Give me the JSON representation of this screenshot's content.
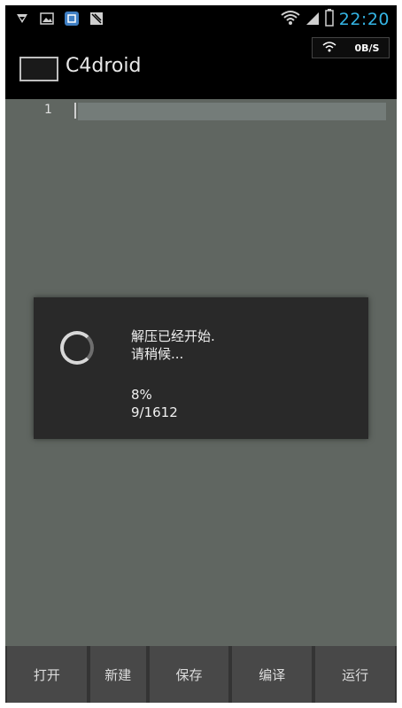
{
  "status_bar": {
    "time": "22:20",
    "icons": [
      "download-icon",
      "image-icon",
      "app-icon",
      "signal-tool-icon",
      "wifi-icon",
      "cell-signal-icon",
      "battery-icon"
    ]
  },
  "action_bar": {
    "title": "C4droid",
    "speed": "0B/S",
    "wifi": "wifi-icon"
  },
  "editor": {
    "line_number": "1"
  },
  "dialog": {
    "line1": "解压已经开始.",
    "line2": "请稍候...",
    "percent": "8%",
    "progress": "9/1612"
  },
  "toolbar": {
    "open": "打开",
    "new": "新建",
    "save": "保存",
    "compile": "编译",
    "run": "运行"
  },
  "colors": {
    "clock": "#34b5e5",
    "background": "#606661",
    "dialog": "#292929"
  }
}
